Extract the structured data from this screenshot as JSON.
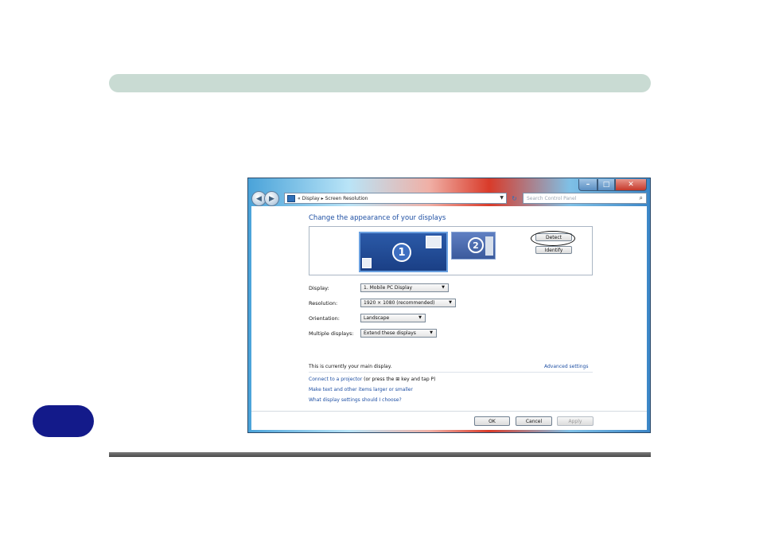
{
  "address_bar": {
    "prefix": "«",
    "crumb1": "Display",
    "sep": "▸",
    "crumb2": "Screen Resolution"
  },
  "search": {
    "placeholder": "Search Control Panel"
  },
  "heading": "Change the appearance of your displays",
  "monitors": {
    "primary": "1",
    "secondary": "2"
  },
  "buttons": {
    "detect": "Detect",
    "identify": "Identify",
    "ok": "OK",
    "cancel": "Cancel",
    "apply": "Apply"
  },
  "settings": {
    "display_label": "Display:",
    "display_value": "1. Mobile PC Display",
    "resolution_label": "Resolution:",
    "resolution_value": "1920 × 1080 (recommended)",
    "orientation_label": "Orientation:",
    "orientation_value": "Landscape",
    "multiple_label": "Multiple displays:",
    "multiple_value": "Extend these displays"
  },
  "main_display_note": "This is currently your main display.",
  "advanced_settings": "Advanced settings",
  "links": {
    "projector": "Connect to a projector",
    "projector_hint_a": " (or press the ",
    "projector_hint_b": " key and tap P)",
    "text_size": "Make text and other items larger or smaller",
    "which_settings": "What display settings should I choose?"
  },
  "colors": {
    "link": "#1e4fa3",
    "side_tab": "#131a8a",
    "band": "#c9dbd3"
  }
}
